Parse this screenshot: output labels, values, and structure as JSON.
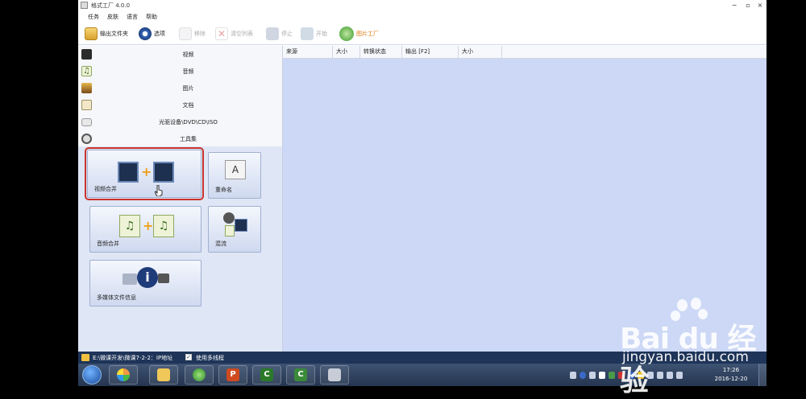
{
  "window": {
    "title": "格式工厂 4.0.0",
    "controls": [
      "−",
      "▫",
      "×"
    ]
  },
  "menu": [
    "任务",
    "皮肤",
    "语言",
    "帮助"
  ],
  "toolbar": [
    {
      "label": "输出文件夹",
      "icon": "folder-icon",
      "enabled": true
    },
    {
      "label": "选项",
      "icon": "options-icon",
      "enabled": true
    },
    {
      "label": "移除",
      "icon": "remove-icon",
      "enabled": false
    },
    {
      "label": "清空列表",
      "icon": "clear-list-icon",
      "enabled": false
    },
    {
      "label": "停止",
      "icon": "stop-icon",
      "enabled": false
    },
    {
      "label": "开始",
      "icon": "start-icon",
      "enabled": false
    },
    {
      "label": "图片工厂",
      "icon": "picture-factory-icon",
      "enabled": true,
      "color": "#e07a10"
    }
  ],
  "categories": [
    {
      "label": "视频",
      "icon": "video-icon"
    },
    {
      "label": "音频",
      "icon": "audio-icon"
    },
    {
      "label": "图片",
      "icon": "picture-icon"
    },
    {
      "label": "文档",
      "icon": "document-icon"
    },
    {
      "label": "光驱设备\\DVD\\CD\\ISO",
      "icon": "disc-drive-icon"
    },
    {
      "label": "工具集",
      "icon": "toolbox-icon"
    }
  ],
  "tools": [
    {
      "label": "视频合并",
      "icon": "video-merge-icon",
      "selected": true
    },
    {
      "label": "重命名",
      "icon": "rename-icon",
      "selected": false
    },
    {
      "label": "音频合并",
      "icon": "audio-merge-icon",
      "selected": false
    },
    {
      "label": "混流",
      "icon": "mux-icon",
      "selected": false
    },
    {
      "label": "多媒体文件信息",
      "icon": "media-info-icon",
      "selected": false
    }
  ],
  "table": {
    "columns": [
      "来源",
      "大小",
      "转换状态",
      "输出 [F2]",
      "大小"
    ],
    "rows": []
  },
  "status": {
    "path": "E:\\微课开发\\微课7-2-2：IP地址",
    "multithread_label": "使用多线程",
    "multithread_checked": true
  },
  "taskbar": {
    "time": "17:26",
    "date": "2016-12-20"
  },
  "watermark": {
    "brand": "Bai du 经验",
    "url": "jingyan.baidu.com"
  },
  "colors": {
    "selection_outline": "#c9332c",
    "content_bg": "#ccd8f5",
    "statusbar_bg": "#1e3458"
  }
}
